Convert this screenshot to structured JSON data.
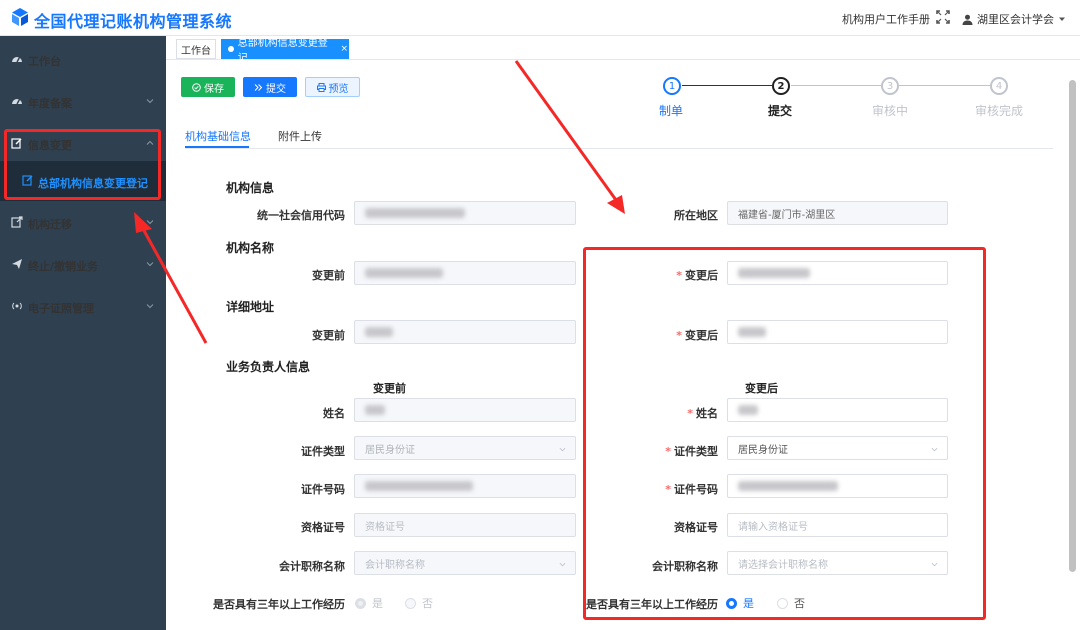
{
  "app": {
    "title": "全国代理记账机构管理系统"
  },
  "header": {
    "manual_label": "机构用户工作手册",
    "user_label": "湖里区会计学会"
  },
  "sidebar": {
    "items": [
      {
        "label": "工作台"
      },
      {
        "label": "年度备案"
      },
      {
        "label": "信息变更"
      },
      {
        "label": "机构迁移"
      },
      {
        "label": "终止/撤销业务"
      },
      {
        "label": "电子证照管理"
      }
    ],
    "submenu_label": "总部机构信息变更登记"
  },
  "tabs": {
    "home": "工作台",
    "active": "总部机构信息变更登记",
    "close": "×"
  },
  "toolbar": {
    "save": "保存",
    "submit": "提交",
    "preview": "预览"
  },
  "steps": [
    {
      "num": "1",
      "label": "制单",
      "state": "done"
    },
    {
      "num": "2",
      "label": "提交",
      "state": "active"
    },
    {
      "num": "3",
      "label": "审核中",
      "state": "pending"
    },
    {
      "num": "4",
      "label": "审核完成",
      "state": "pending"
    }
  ],
  "subtabs": {
    "basic": "机构基础信息",
    "attach": "附件上传"
  },
  "form": {
    "sec_org_info": "机构信息",
    "credit_code_label": "统一社会信用代码",
    "region_label": "所在地区",
    "region_value": "福建省-厦门市-湖里区",
    "sec_org_name": "机构名称",
    "before_label": "变更前",
    "after_label": "变更后",
    "sec_address": "详细地址",
    "sec_person": "业务负责人信息",
    "col_before": "变更前",
    "col_after": "变更后",
    "name_label": "姓名",
    "id_type_label": "证件类型",
    "id_type_value": "居民身份证",
    "id_no_label": "证件号码",
    "qual_label": "资格证号",
    "qual_placeholder_before": "资格证号",
    "qual_placeholder_after": "请输入资格证号",
    "title_label": "会计职称名称",
    "title_placeholder_before": "会计职称名称",
    "title_placeholder_after": "请选择会计职称名称",
    "experience_label": "是否具有三年以上工作经历",
    "yes": "是",
    "no": "否",
    "required_mark": "*"
  },
  "colors": {
    "accent": "#1677ff",
    "sidebar_bg": "#2f4050",
    "save_green": "#19b35a",
    "highlight_red": "#f52828"
  }
}
